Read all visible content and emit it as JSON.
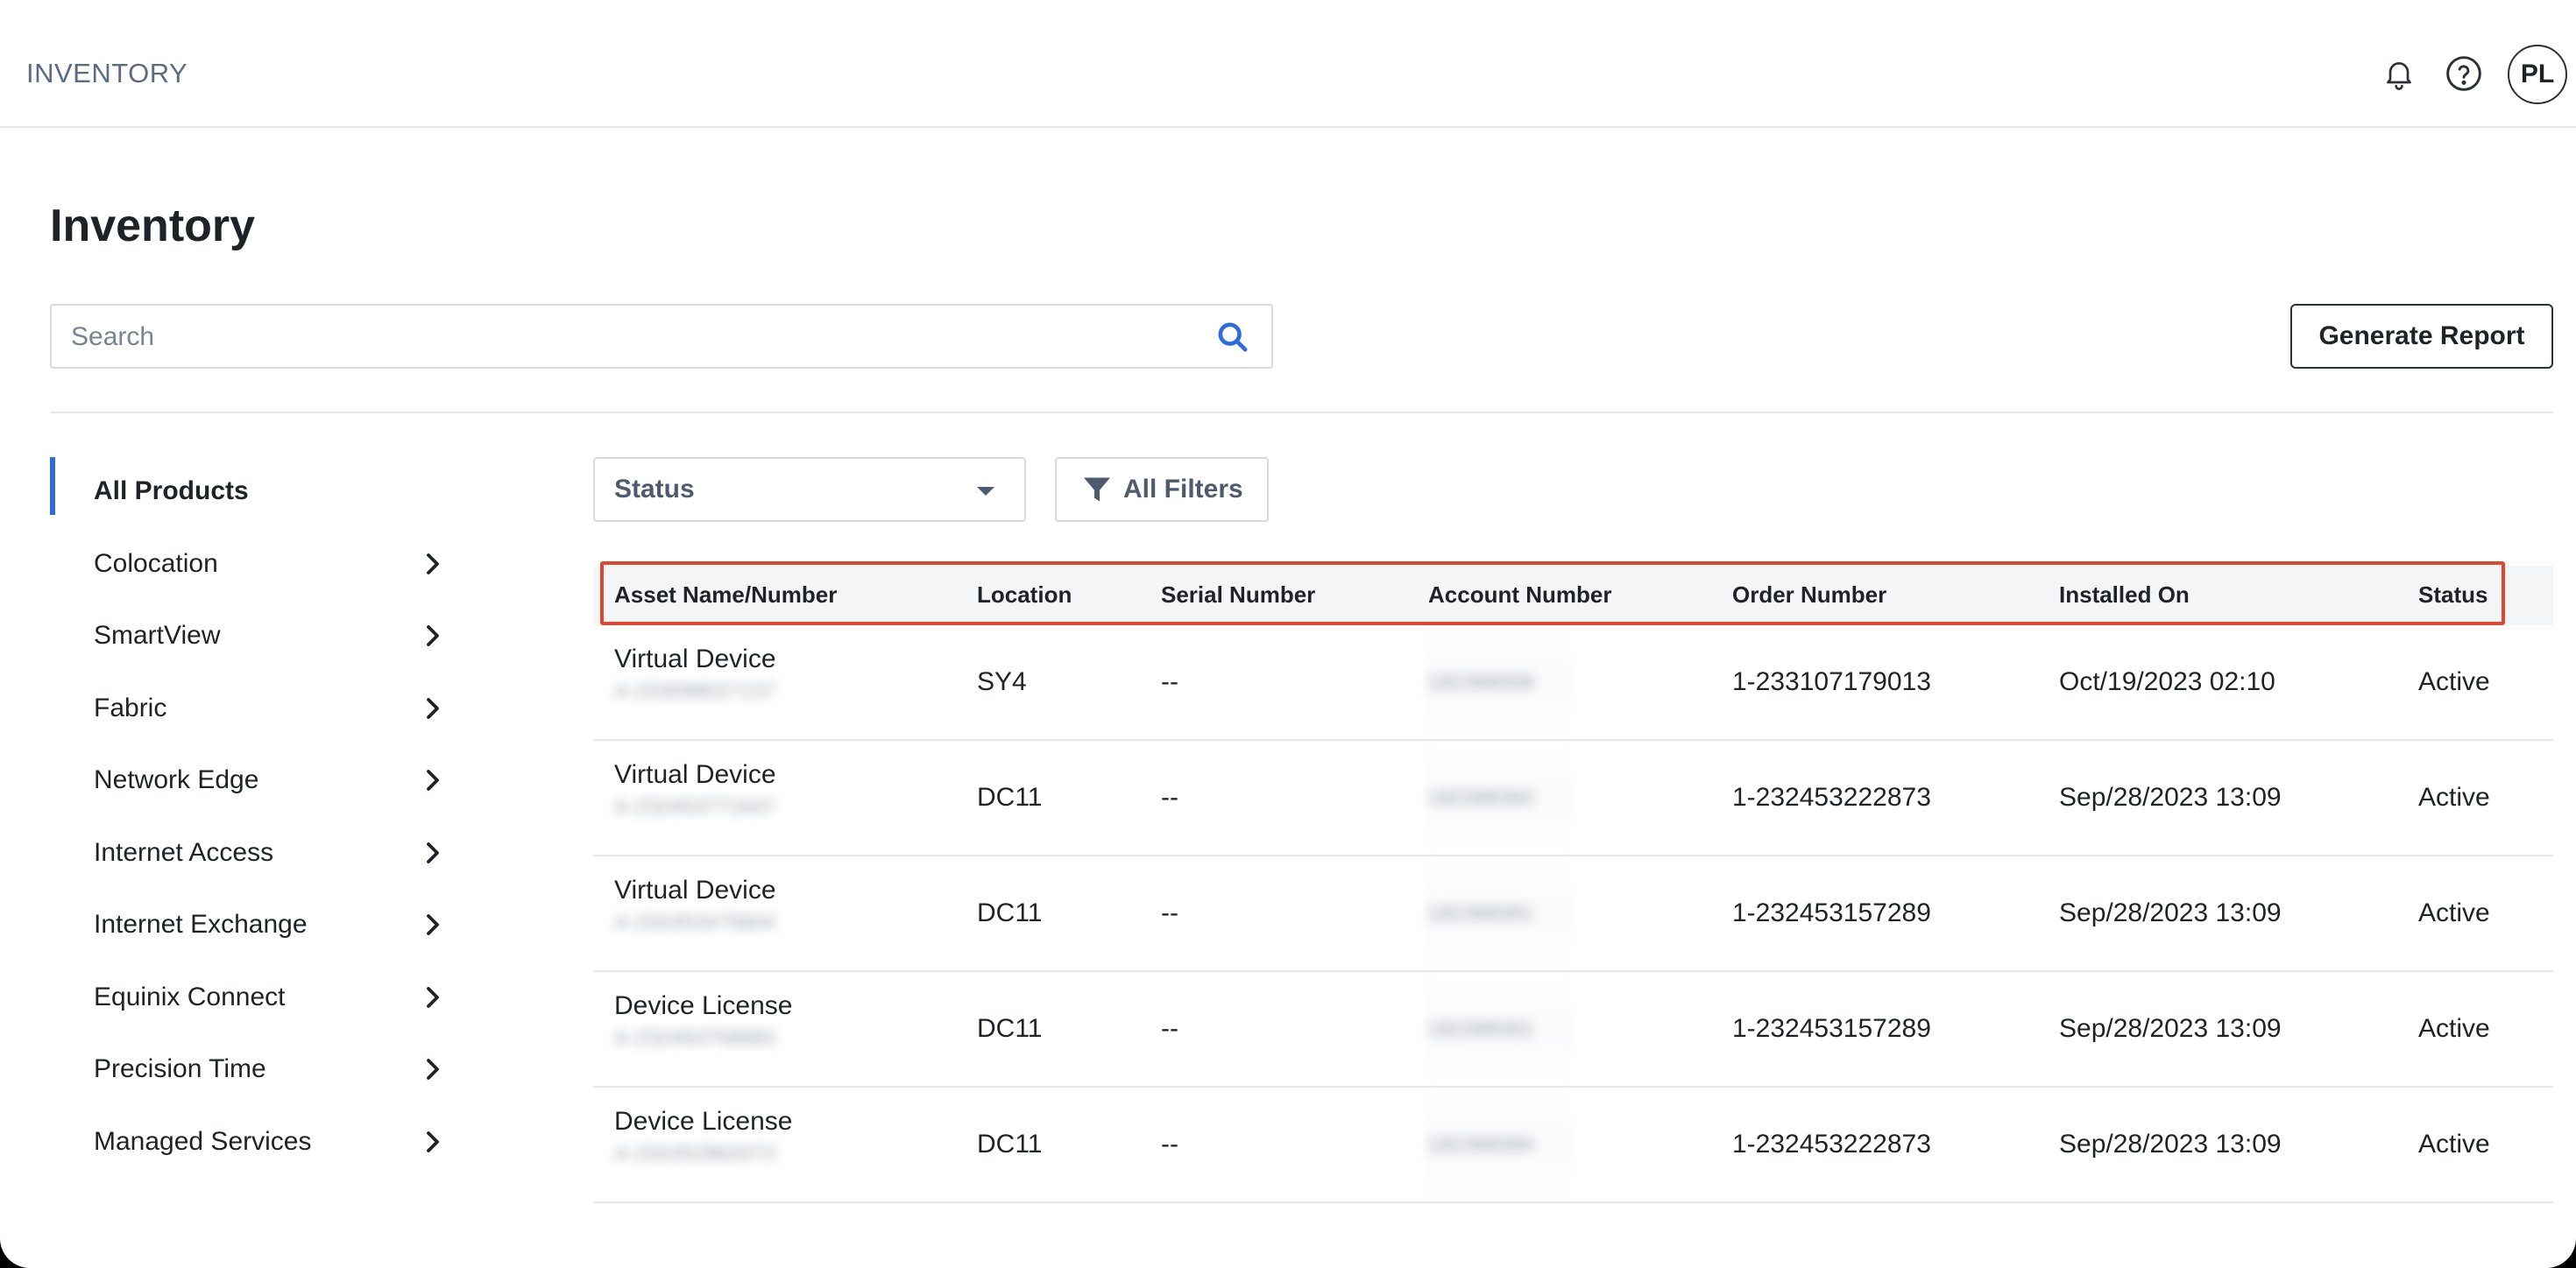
{
  "header": {
    "app_title": "INVENTORY",
    "avatar_initials": "PL"
  },
  "page": {
    "title": "Inventory"
  },
  "search": {
    "placeholder": "Search"
  },
  "actions": {
    "generate_report": "Generate Report"
  },
  "sidebar": {
    "items": [
      {
        "label": "All Products",
        "active": true
      },
      {
        "label": "Colocation"
      },
      {
        "label": "SmartView"
      },
      {
        "label": "Fabric"
      },
      {
        "label": "Network Edge"
      },
      {
        "label": "Internet Access"
      },
      {
        "label": "Internet Exchange"
      },
      {
        "label": "Equinix Connect"
      },
      {
        "label": "Precision Time"
      },
      {
        "label": "Managed Services"
      }
    ]
  },
  "filters": {
    "status_label": "Status",
    "all_filters_label": "All Filters"
  },
  "table": {
    "columns": [
      "Asset Name/Number",
      "Location",
      "Serial Number",
      "Account Number",
      "Order Number",
      "Installed On",
      "Status"
    ],
    "rows": [
      {
        "name": "Virtual Device",
        "asset_number": "A-233098027137",
        "location": "SY4",
        "serial": "--",
        "account": "182398508",
        "order": "1-233107179013",
        "installed": "Oct/19/2023 02:10",
        "status": "Active"
      },
      {
        "name": "Virtual Device",
        "asset_number": "A-232453771647",
        "location": "DC11",
        "serial": "--",
        "account": "182398394",
        "order": "1-232453222873",
        "installed": "Sep/28/2023 13:09",
        "status": "Active"
      },
      {
        "name": "Virtual Device",
        "asset_number": "A-232453475604",
        "location": "DC11",
        "serial": "--",
        "account": "182398391",
        "order": "1-232453157289",
        "installed": "Sep/28/2023 13:09",
        "status": "Active"
      },
      {
        "name": "Device License",
        "asset_number": "A-232493758983",
        "location": "DC11",
        "serial": "--",
        "account": "182398391",
        "order": "1-232453157289",
        "installed": "Sep/28/2023 13:09",
        "status": "Active"
      },
      {
        "name": "Device License",
        "asset_number": "A-232452862073",
        "location": "DC11",
        "serial": "--",
        "account": "182398394",
        "order": "1-232453222873",
        "installed": "Sep/28/2023 13:09",
        "status": "Active"
      }
    ]
  },
  "colors": {
    "accent": "#2d6cdf",
    "highlight": "#e2462f"
  }
}
